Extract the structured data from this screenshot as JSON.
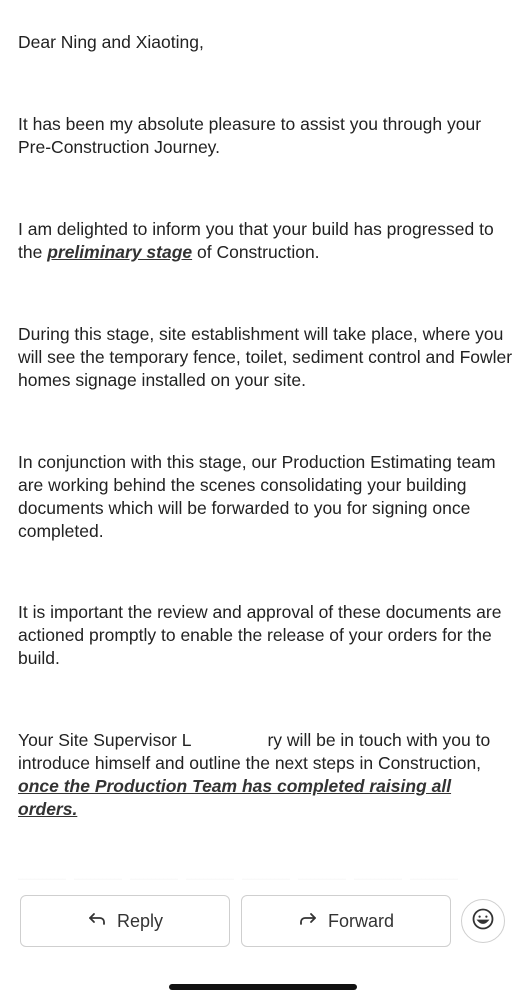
{
  "email": {
    "greeting": "Dear Ning and Xiaoting,",
    "p1": "It has been my absolute pleasure to assist you through your Pre-Construction Journey.",
    "p2_before": "I am delighted to inform you that your build has progressed to the ",
    "p2_link": "preliminary stage",
    "p2_after": " of Construction.",
    "p3": "During this stage, site establishment will take place, where you will see the temporary fence, toilet, sediment control and Fowler homes signage installed on your site.",
    "p4": "In conjunction with this stage, our Production Estimating team are working behind the scenes consolidating your building documents which will be forwarded to you for signing once completed.",
    "p5": "It is important the review and approval of these documents are actioned promptly to enable the release of your orders for the build.",
    "p6_before": "Your Site Supervisor L",
    "p6_after": "ry will be in touch with you to introduce himself and outline the next steps in Construction, ",
    "p6_link": "once the Production Team has completed raising all orders."
  },
  "actions": {
    "reply_label": "Reply",
    "forward_label": "Forward",
    "reply_icon": "reply-arrow-icon",
    "forward_icon": "forward-arrow-icon",
    "emoji_icon": "emoji-icon"
  }
}
